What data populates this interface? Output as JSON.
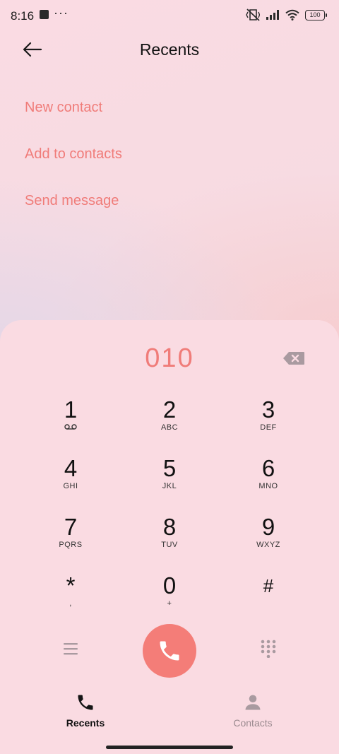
{
  "status_bar": {
    "time": "8:16",
    "overflow": "···",
    "battery": "100"
  },
  "header": {
    "title": "Recents",
    "back_icon": "arrow-left-icon"
  },
  "actions": [
    {
      "label": "New contact"
    },
    {
      "label": "Add to contacts"
    },
    {
      "label": "Send message"
    }
  ],
  "dialer": {
    "number": "010",
    "keys": [
      {
        "digit": "1",
        "letters": ""
      },
      {
        "digit": "2",
        "letters": "ABC"
      },
      {
        "digit": "3",
        "letters": "DEF"
      },
      {
        "digit": "4",
        "letters": "GHI"
      },
      {
        "digit": "5",
        "letters": "JKL"
      },
      {
        "digit": "6",
        "letters": "MNO"
      },
      {
        "digit": "7",
        "letters": "PQRS"
      },
      {
        "digit": "8",
        "letters": "TUV"
      },
      {
        "digit": "9",
        "letters": "WXYZ"
      },
      {
        "digit": "*",
        "letters": ","
      },
      {
        "digit": "0",
        "letters": "+"
      },
      {
        "digit": "#",
        "letters": ""
      }
    ]
  },
  "bottom_nav": {
    "tabs": [
      {
        "label": "Recents",
        "active": true
      },
      {
        "label": "Contacts",
        "active": false
      }
    ]
  },
  "colors": {
    "accent": "#f07c79",
    "call_button": "#f47d78",
    "text_primary": "#111111",
    "text_muted": "#9a8a8f"
  }
}
